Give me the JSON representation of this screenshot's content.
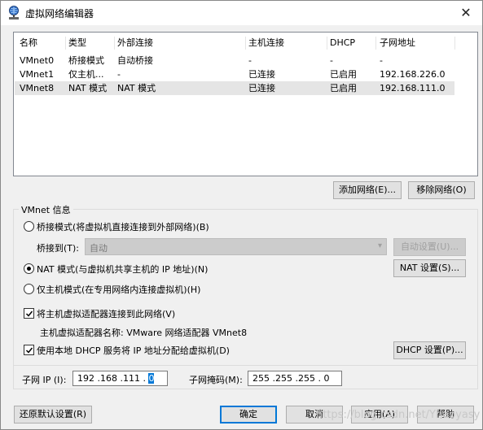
{
  "window": {
    "title": "虚拟网络编辑器",
    "close_glyph": "✕"
  },
  "table": {
    "headers": [
      "名称",
      "类型",
      "外部连接",
      "主机连接",
      "DHCP",
      "子网地址"
    ],
    "rows": [
      {
        "name": "VMnet0",
        "type": "桥接模式",
        "external": "自动桥接",
        "host": "-",
        "dhcp": "-",
        "subnet": "-"
      },
      {
        "name": "VMnet1",
        "type": "仅主机...",
        "external": "-",
        "host": "已连接",
        "dhcp": "已启用",
        "subnet": "192.168.226.0"
      },
      {
        "name": "VMnet8",
        "type": "NAT 模式",
        "external": "NAT 模式",
        "host": "已连接",
        "dhcp": "已启用",
        "subnet": "192.168.111.0"
      }
    ],
    "selected_row": 2
  },
  "buttons": {
    "add_network": "添加网络(E)...",
    "remove_network": "移除网络(O)",
    "auto_settings": "自动设置(U)...",
    "nat_settings": "NAT 设置(S)...",
    "dhcp_settings": "DHCP 设置(P)...",
    "restore_defaults": "还原默认设置(R)",
    "ok": "确定",
    "cancel": "取消",
    "apply": "应用(A)",
    "help": "帮助"
  },
  "vmnet_info": {
    "group_title": "VMnet 信息",
    "bridged_label": "桥接模式(将虚拟机直接连接到外部网络)(B)",
    "bridged_to_label": "桥接到(T):",
    "bridged_to_value": "自动",
    "nat_label": "NAT 模式(与虚拟机共享主机的 IP 地址)(N)",
    "host_only_label": "仅主机模式(在专用网络内连接虚拟机)(H)",
    "selected_mode": "nat",
    "connect_adapter_label": "将主机虚拟适配器连接到此网络(V)",
    "connect_adapter_checked": true,
    "adapter_name_label": "主机虚拟适配器名称: VMware 网络适配器 VMnet8",
    "use_dhcp_label": "使用本地 DHCP 服务将 IP 地址分配给虚拟机(D)",
    "use_dhcp_checked": true,
    "subnet_ip_label": "子网 IP (I):",
    "subnet_ip_value": "192 .168 .111 . ",
    "subnet_ip_last": "0",
    "subnet_mask_label": "子网掩码(M):",
    "subnet_mask_value": "255 .255 .255 . 0"
  },
  "watermark": "https://blog.csdn.net/Yhaoyasy"
}
